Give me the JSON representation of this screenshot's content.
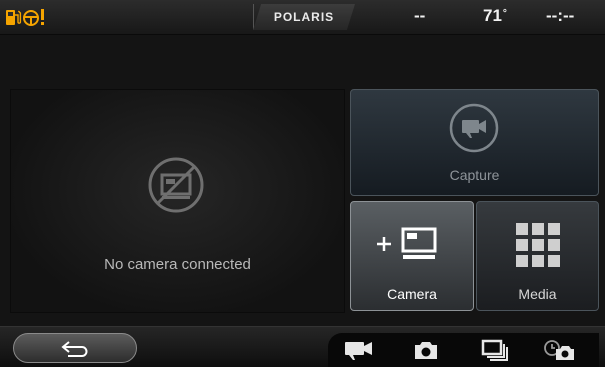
{
  "status_bar": {
    "brand": "POLARIS",
    "left_value": "--",
    "temperature": "71",
    "temperature_unit": "°",
    "clock": "--:--",
    "warning_icons": [
      "fuel-icon",
      "steering-warning-icon"
    ],
    "warning_color": "#f5a400"
  },
  "preview": {
    "message": "No camera connected",
    "icon": "no-camera-icon"
  },
  "tiles": {
    "capture": {
      "label": "Capture",
      "icon": "video-camera-icon"
    },
    "camera": {
      "label": "Camera",
      "icon": "add-camera-icon"
    },
    "media": {
      "label": "Media",
      "icon": "grid-icon"
    }
  },
  "bottom_bar": {
    "back_icon": "back-arrow-icon",
    "modes": [
      "video-mode-icon",
      "photo-mode-icon",
      "burst-mode-icon",
      "timelapse-mode-icon"
    ]
  }
}
